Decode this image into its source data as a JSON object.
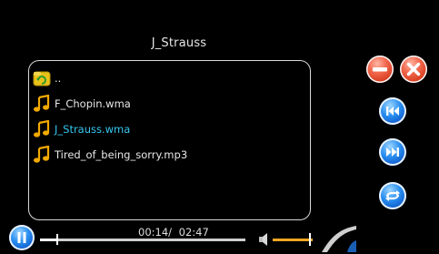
{
  "folder": {
    "title": "J_Strauss"
  },
  "files": [
    {
      "name": "..",
      "type": "parent-folder",
      "selected": false
    },
    {
      "name": "F_Chopin.wma",
      "type": "music-file",
      "selected": false
    },
    {
      "name": "J_Strauss.wma",
      "type": "music-file",
      "selected": true
    },
    {
      "name": "Tired_of_being_sorry.mp3",
      "type": "music-file",
      "selected": false
    }
  ],
  "controls": {
    "minimize_icon": "minus-circle-icon",
    "close_icon": "close-x-icon",
    "previous_icon": "skip-previous-icon",
    "next_icon": "skip-next-icon",
    "repeat_icon": "repeat-icon",
    "pause_icon": "pause-icon",
    "volume_icon": "speaker-icon"
  },
  "playback": {
    "elapsed": "00:14/",
    "total": "02:47",
    "progress": 0.084,
    "volume": 0.93
  },
  "colors": {
    "accent_blue": "#36c7f0",
    "volume_orange": "#f5a623",
    "button_red": "#e8482a",
    "button_blue": "#1a6fe0"
  }
}
